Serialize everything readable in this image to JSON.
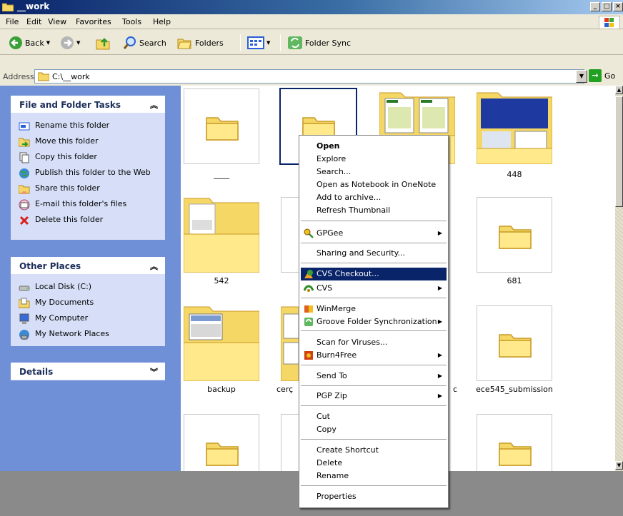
{
  "window": {
    "title": "__work"
  },
  "menubar": [
    "File",
    "Edit",
    "View",
    "Favorites",
    "Tools",
    "Help"
  ],
  "toolbar": {
    "back": "Back",
    "search": "Search",
    "folders": "Folders",
    "folder_sync": "Folder Sync"
  },
  "address": {
    "label": "Address",
    "value": "C:\\__work",
    "go": "Go"
  },
  "left_pane": {
    "file_tasks": {
      "title": "File and Folder Tasks",
      "items": [
        "Rename this folder",
        "Move this folder",
        "Copy this folder",
        "Publish this folder to the Web",
        "Share this folder",
        "E-mail this folder's files",
        "Delete this folder"
      ]
    },
    "other_places": {
      "title": "Other Places",
      "items": [
        "Local Disk (C:)",
        "My Documents",
        "My Computer",
        "My Network Places"
      ]
    },
    "details": {
      "title": "Details"
    }
  },
  "folders": {
    "row1": [
      "____",
      "",
      "",
      "448"
    ],
    "row2": [
      "542",
      "681"
    ],
    "row3": [
      "backup",
      "cerç",
      "c",
      "ece545_submission"
    ]
  },
  "context_menu": {
    "group1": [
      "Open",
      "Explore",
      "Search...",
      "Open as Notebook in OneNote",
      "Add to archive...",
      "Refresh Thumbnail"
    ],
    "gpgee": "GPGee",
    "sharing": "Sharing and Security...",
    "cvs_checkout": "CVS Checkout...",
    "cvs": "CVS",
    "winmerge": "WinMerge",
    "groove": "Groove Folder Synchronization",
    "scan": "Scan for Viruses...",
    "burn": "Burn4Free",
    "send_to": "Send To",
    "pgp_zip": "PGP Zip",
    "cut": "Cut",
    "copy": "Copy",
    "create_shortcut": "Create Shortcut",
    "delete": "Delete",
    "rename": "Rename",
    "properties": "Properties"
  }
}
